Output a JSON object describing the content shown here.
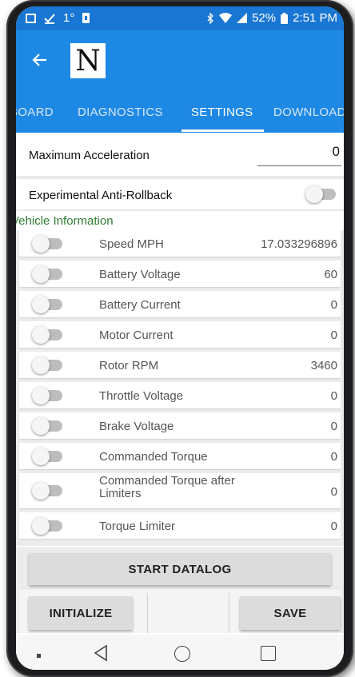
{
  "status_bar": {
    "signal_label": "1°",
    "battery_percent": "52%",
    "time": "2:51 PM"
  },
  "app_bar": {
    "back_icon": "arrow-left-icon",
    "logo_letter": "N"
  },
  "tabs": [
    {
      "label": "BOARD",
      "active": false
    },
    {
      "label": "DIAGNOSTICS",
      "active": false
    },
    {
      "label": "SETTINGS",
      "active": true
    },
    {
      "label": "DOWNLOAD",
      "active": false
    }
  ],
  "settings": {
    "max_acceleration_label": "Maximum Acceleration",
    "max_acceleration_value": "0",
    "anti_rollback_label": "Experimental Anti-Rollback",
    "anti_rollback_on": false
  },
  "vehicle_info": {
    "section_title": "Vehicle Information",
    "items": [
      {
        "name": "Speed MPH",
        "value": "17.033296896",
        "enabled": false
      },
      {
        "name": "Battery Voltage",
        "value": "60",
        "enabled": false
      },
      {
        "name": "Battery Current",
        "value": "0",
        "enabled": false
      },
      {
        "name": "Motor Current",
        "value": "0",
        "enabled": false
      },
      {
        "name": "Rotor RPM",
        "value": "3460",
        "enabled": false
      },
      {
        "name": "Throttle Voltage",
        "value": "0",
        "enabled": false
      },
      {
        "name": "Brake Voltage",
        "value": "0",
        "enabled": false
      },
      {
        "name": "Commanded Torque",
        "value": "0",
        "enabled": false
      },
      {
        "name": "Commanded Torque after Limiters",
        "value": "0",
        "enabled": false
      },
      {
        "name": "Torque Limiter",
        "value": "0",
        "enabled": false
      }
    ]
  },
  "buttons": {
    "start_datalog": "START DATALOG",
    "initialize": "INITIALIZE",
    "save": "SAVE"
  },
  "colors": {
    "app_bar": "#1e88e5",
    "status_bar": "#1976d2",
    "section_title": "#2e7d32"
  }
}
